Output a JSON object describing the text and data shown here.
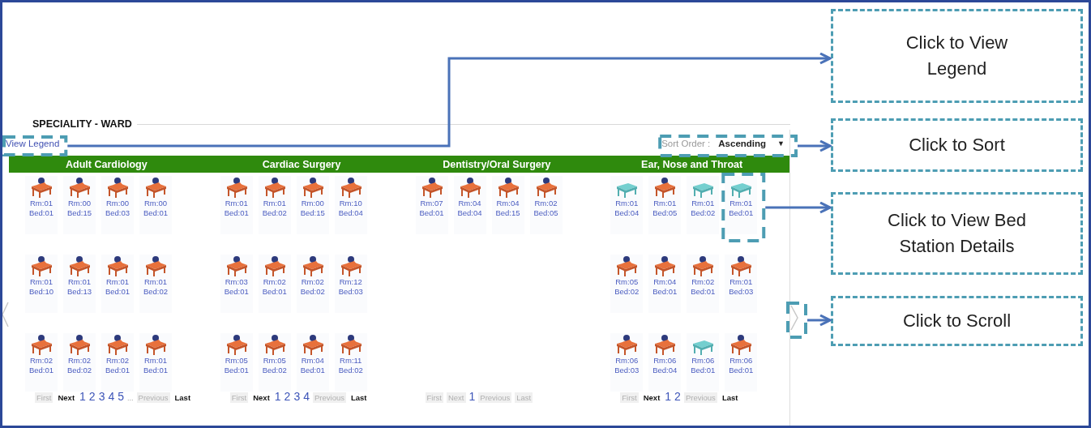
{
  "panel": {
    "title": "SPECIALITY - WARD",
    "legend_link": "View Legend",
    "sort": {
      "label": "Sort Order :",
      "value": "Ascending",
      "caret": "▼"
    }
  },
  "specialities": [
    {
      "name": "Adult Cardiology",
      "beds": [
        {
          "room": "Rm:01",
          "bed": "Bed:01",
          "occupied": true,
          "highlighted": false
        },
        {
          "room": "Rm:00",
          "bed": "Bed:15",
          "occupied": true,
          "highlighted": false
        },
        {
          "room": "Rm:00",
          "bed": "Bed:03",
          "occupied": true,
          "highlighted": false
        },
        {
          "room": "Rm:00",
          "bed": "Bed:01",
          "occupied": true,
          "highlighted": false
        },
        {
          "room": "Rm:01",
          "bed": "Bed:10",
          "occupied": true,
          "highlighted": false
        },
        {
          "room": "Rm:01",
          "bed": "Bed:13",
          "occupied": true,
          "highlighted": false
        },
        {
          "room": "Rm:01",
          "bed": "Bed:01",
          "occupied": true,
          "highlighted": false
        },
        {
          "room": "Rm:01",
          "bed": "Bed:02",
          "occupied": true,
          "highlighted": false
        },
        {
          "room": "Rm:02",
          "bed": "Bed:01",
          "occupied": true,
          "highlighted": false
        },
        {
          "room": "Rm:02",
          "bed": "Bed:02",
          "occupied": true,
          "highlighted": false
        },
        {
          "room": "Rm:02",
          "bed": "Bed:01",
          "occupied": true,
          "highlighted": false
        },
        {
          "room": "Rm:01",
          "bed": "Bed:01",
          "occupied": true,
          "highlighted": false
        }
      ],
      "pager": [
        {
          "label": "First",
          "kind": "nav",
          "disabled": true
        },
        {
          "label": "Next",
          "kind": "nav",
          "disabled": false
        },
        {
          "label": "1",
          "kind": "page"
        },
        {
          "label": "2",
          "kind": "page"
        },
        {
          "label": "3",
          "kind": "page"
        },
        {
          "label": "4",
          "kind": "page"
        },
        {
          "label": "5",
          "kind": "page"
        },
        {
          "label": "...",
          "kind": "ellipsis"
        },
        {
          "label": "Previous",
          "kind": "nav",
          "disabled": true
        },
        {
          "label": "Last",
          "kind": "nav",
          "disabled": false
        }
      ]
    },
    {
      "name": "Cardiac Surgery",
      "beds": [
        {
          "room": "Rm:01",
          "bed": "Bed:01",
          "occupied": true,
          "highlighted": false
        },
        {
          "room": "Rm:01",
          "bed": "Bed:02",
          "occupied": true,
          "highlighted": false
        },
        {
          "room": "Rm:00",
          "bed": "Bed:15",
          "occupied": true,
          "highlighted": false
        },
        {
          "room": "Rm:10",
          "bed": "Bed:04",
          "occupied": true,
          "highlighted": false
        },
        {
          "room": "Rm:03",
          "bed": "Bed:01",
          "occupied": true,
          "highlighted": false
        },
        {
          "room": "Rm:02",
          "bed": "Bed:01",
          "occupied": true,
          "highlighted": false
        },
        {
          "room": "Rm:02",
          "bed": "Bed:02",
          "occupied": true,
          "highlighted": false
        },
        {
          "room": "Rm:12",
          "bed": "Bed:03",
          "occupied": true,
          "highlighted": false
        },
        {
          "room": "Rm:05",
          "bed": "Bed:01",
          "occupied": true,
          "highlighted": false
        },
        {
          "room": "Rm:05",
          "bed": "Bed:02",
          "occupied": true,
          "highlighted": false
        },
        {
          "room": "Rm:04",
          "bed": "Bed:01",
          "occupied": true,
          "highlighted": false
        },
        {
          "room": "Rm:11",
          "bed": "Bed:02",
          "occupied": true,
          "highlighted": false
        }
      ],
      "pager": [
        {
          "label": "First",
          "kind": "nav",
          "disabled": true
        },
        {
          "label": "Next",
          "kind": "nav",
          "disabled": false
        },
        {
          "label": "1",
          "kind": "page"
        },
        {
          "label": "2",
          "kind": "page"
        },
        {
          "label": "3",
          "kind": "page"
        },
        {
          "label": "4",
          "kind": "page"
        },
        {
          "label": "Previous",
          "kind": "nav",
          "disabled": true
        },
        {
          "label": "Last",
          "kind": "nav",
          "disabled": false
        }
      ]
    },
    {
      "name": "Dentistry/Oral Surgery",
      "beds": [
        {
          "room": "Rm:07",
          "bed": "Bed:01",
          "occupied": true,
          "highlighted": false
        },
        {
          "room": "Rm:04",
          "bed": "Bed:04",
          "occupied": true,
          "highlighted": false
        },
        {
          "room": "Rm:04",
          "bed": "Bed:15",
          "occupied": true,
          "highlighted": false
        },
        {
          "room": "Rm:02",
          "bed": "Bed:05",
          "occupied": true,
          "highlighted": false
        }
      ],
      "pager": [
        {
          "label": "First",
          "kind": "nav",
          "disabled": true
        },
        {
          "label": "Next",
          "kind": "nav",
          "disabled": true
        },
        {
          "label": "1",
          "kind": "page"
        },
        {
          "label": "Previous",
          "kind": "nav",
          "disabled": true
        },
        {
          "label": "Last",
          "kind": "nav",
          "disabled": true
        }
      ]
    },
    {
      "name": "Ear, Nose and Throat",
      "beds": [
        {
          "room": "Rm:01",
          "bed": "Bed:04",
          "occupied": false,
          "highlighted": false
        },
        {
          "room": "Rm:01",
          "bed": "Bed:05",
          "occupied": true,
          "highlighted": false
        },
        {
          "room": "Rm:01",
          "bed": "Bed:02",
          "occupied": false,
          "highlighted": false
        },
        {
          "room": "Rm:01",
          "bed": "Bed:01",
          "occupied": false,
          "highlighted": true
        },
        {
          "room": "Rm:05",
          "bed": "Bed:02",
          "occupied": true,
          "highlighted": false
        },
        {
          "room": "Rm:04",
          "bed": "Bed:01",
          "occupied": true,
          "highlighted": false
        },
        {
          "room": "Rm:02",
          "bed": "Bed:01",
          "occupied": true,
          "highlighted": false
        },
        {
          "room": "Rm:01",
          "bed": "Bed:03",
          "occupied": true,
          "highlighted": false
        },
        {
          "room": "Rm:06",
          "bed": "Bed:03",
          "occupied": true,
          "highlighted": false
        },
        {
          "room": "Rm:06",
          "bed": "Bed:04",
          "occupied": true,
          "highlighted": false
        },
        {
          "room": "Rm:06",
          "bed": "Bed:01",
          "occupied": false,
          "highlighted": false
        },
        {
          "room": "Rm:06",
          "bed": "Bed:01",
          "occupied": true,
          "highlighted": false
        }
      ],
      "pager": [
        {
          "label": "First",
          "kind": "nav",
          "disabled": true
        },
        {
          "label": "Next",
          "kind": "nav",
          "disabled": false
        },
        {
          "label": "1",
          "kind": "page"
        },
        {
          "label": "2",
          "kind": "page"
        },
        {
          "label": "Previous",
          "kind": "nav",
          "disabled": true
        },
        {
          "label": "Last",
          "kind": "nav",
          "disabled": false
        }
      ]
    }
  ],
  "annotations": [
    {
      "kind": "legend",
      "text": "Click to View Legend"
    },
    {
      "kind": "sort",
      "text": "Click to Sort"
    },
    {
      "kind": "bed",
      "text": "Click to View Bed Station Details"
    },
    {
      "kind": "scroll",
      "text": "Click to Scroll"
    }
  ]
}
